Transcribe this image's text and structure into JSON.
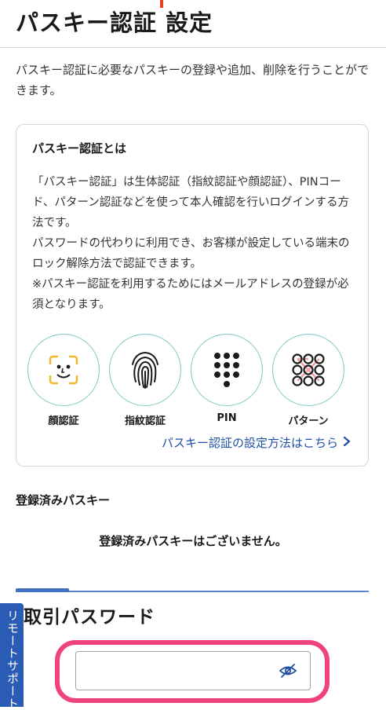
{
  "page": {
    "title": "パスキー認証 設定",
    "intro": "パスキー認証に必要なパスキーの登録や追加、削除を行うことができます。"
  },
  "info_card": {
    "title": "パスキー認証とは",
    "body": [
      "「パスキー認証」は生体認証（指紋認証や顔認証）、PINコード、パターン認証などを使って本人確認を行いログインする方法です。",
      "パスワードの代わりに利用でき、お客様が設定している端末のロック解除方法で認証できます。",
      "※パスキー認証を利用するためにはメールアドレスの登録が必須となります。"
    ],
    "methods": [
      {
        "label": "顔認証",
        "icon": "face-icon"
      },
      {
        "label": "指紋認証",
        "icon": "fingerprint-icon"
      },
      {
        "label": "PIN",
        "icon": "pin-keypad-icon"
      },
      {
        "label": "パターン",
        "icon": "pattern-grid-icon"
      }
    ],
    "setup_link": "パスキー認証の設定方法はこちら",
    "link_icon": "chevron-right-icon"
  },
  "registered": {
    "heading": "登録済みパスキー",
    "empty_message": "登録済みパスキーはございません。"
  },
  "password_section": {
    "heading": "取引パスワード",
    "input_value": "",
    "toggle_icon": "eye-off-icon"
  },
  "remote_support": {
    "label": "リモートサポート"
  },
  "colors": {
    "accent_blue": "#2a5bb5",
    "link_blue": "#1f4fa6",
    "highlight_pink": "#f0437e",
    "icon_teal": "#7ec8c5",
    "face_frame_yellow": "#f2b92c"
  }
}
